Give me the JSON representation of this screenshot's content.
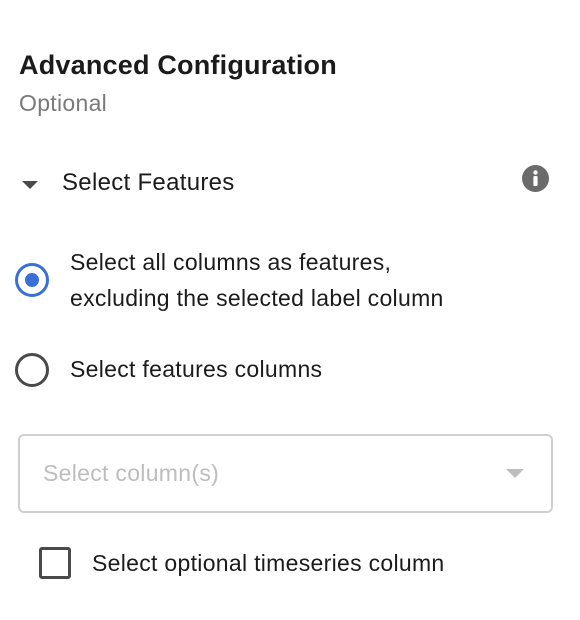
{
  "panel": {
    "title": "Advanced Configuration",
    "subtitle": "Optional"
  },
  "section": {
    "label": "Select Features",
    "expanded": true,
    "caret_icon": "caret-down-icon",
    "info_icon": "info-circle-icon"
  },
  "radio_options": [
    {
      "line1": "Select all columns as features,",
      "line2": "excluding the selected label column",
      "checked": true
    },
    {
      "line1": "Select features columns",
      "checked": false
    }
  ],
  "column_select": {
    "placeholder": "Select column(s)",
    "chevron_icon": "chevron-down-icon"
  },
  "timeseries_checkbox": {
    "label": "Select optional timeseries column",
    "checked": false
  },
  "colors": {
    "accent": "#3a6fd8",
    "text": "#1b1b1b",
    "muted": "#7a7a7a",
    "placeholder": "#bdbdbd",
    "border": "#cfcfcf"
  }
}
